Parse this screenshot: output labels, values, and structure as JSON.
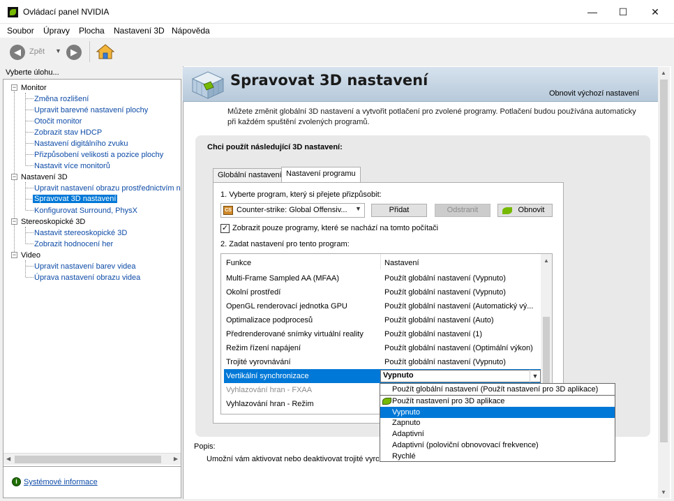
{
  "window": {
    "title": "Ovládací panel NVIDIA",
    "minimize": "—",
    "maximize": "☐",
    "close": "✕"
  },
  "menu": [
    "Soubor",
    "Úpravy",
    "Plocha",
    "Nastavení 3D",
    "Nápověda"
  ],
  "toolbar": {
    "back_label": "Zpět",
    "back_glyph": "◀",
    "forward_glyph": "▶",
    "dropdown_glyph": "▼"
  },
  "sidebar": {
    "header": "Vyberte úlohu...",
    "categories": [
      {
        "label": "Monitor",
        "tasks": [
          "Změna rozlišení",
          "Upravit barevné nastavení plochy",
          "Otočit monitor",
          "Zobrazit stav HDCP",
          "Nastavení digitálního zvuku",
          "Přizpůsobení velikosti a pozice plochy",
          "Nastavit více monitorů"
        ]
      },
      {
        "label": "Nastavení 3D",
        "tasks": [
          "Upravit nastavení obrazu prostřednictvím n",
          "Spravovat 3D nastavení",
          "Konfigurovat Surround, PhysX"
        ]
      },
      {
        "label": "Stereoskopické 3D",
        "tasks": [
          "Nastavit stereoskopické 3D",
          "Zobrazit hodnocení her"
        ]
      },
      {
        "label": "Video",
        "tasks": [
          "Upravit nastavení barev videa",
          "Úprava nastavení obrazu videa"
        ]
      }
    ],
    "selected_task": "Spravovat 3D nastavení",
    "expander_glyph": "−",
    "system_info": "Systémové informace",
    "system_info_glyph": "i"
  },
  "main": {
    "title": "Spravovat 3D nastavení",
    "restore_defaults": "Obnovit výchozí nastavení",
    "description": "Můžete změnit globální 3D nastavení a vytvořit potlačení pro zvolené programy. Potlačení budou používána automaticky při každém spuštění zvolených programů.",
    "settings_heading": "Chci použít následující 3D nastavení:",
    "tabs": [
      "Globální nastavení",
      "Nastavení programu"
    ],
    "active_tab": "Nastavení programu",
    "step1": "1. Vyberte program, který si přejete přizpůsobit:",
    "program": {
      "name": "Counter-strike: Global Offensiv...",
      "icon": "cs-icon",
      "icon_text": "CS"
    },
    "add_button": "Přidat",
    "remove_button": "Odstranit",
    "refresh_button": "Obnovit",
    "checkbox_label": "Zobrazit pouze programy, které se nachází na tomto počítači",
    "checkbox_checked": true,
    "checkbox_glyph": "✓",
    "step2": "2. Zadat nastavení pro tento program:",
    "table": {
      "headers": [
        "Funkce",
        "Nastavení"
      ],
      "rows": [
        {
          "feature": "Multi-Frame Sampled AA (MFAA)",
          "setting": "Použít globální nastavení (Vypnuto)"
        },
        {
          "feature": "Okolní prostředí",
          "setting": "Použít globální nastavení (Vypnuto)"
        },
        {
          "feature": "OpenGL renderovací jednotka GPU",
          "setting": "Použít globální nastavení (Automatický vý..."
        },
        {
          "feature": "Optimalizace podprocesů",
          "setting": "Použít globální nastavení (Auto)"
        },
        {
          "feature": "Předrenderované snímky virtuální reality",
          "setting": "Použít globální nastavení (1)"
        },
        {
          "feature": "Režim řízení napájení",
          "setting": "Použít globální nastavení (Optimální výkon)"
        },
        {
          "feature": "Trojité vyrovnávání",
          "setting": "Použít globální nastavení (Vypnuto)"
        },
        {
          "feature": "Vertikální synchronizace",
          "setting": "Vypnuto"
        },
        {
          "feature": "Vyhlazování hran - FXAA",
          "setting": ""
        },
        {
          "feature": "Vyhlazování hran - Režim",
          "setting": ""
        }
      ],
      "selected_row": "Vertikální synchronizace",
      "disabled_row": "Vyhlazování hran - FXAA"
    },
    "dropdown": {
      "current": "Vypnuto",
      "options": [
        "Použít globální nastavení (Použít nastavení pro 3D aplikace)",
        "Použít nastavení pro 3D aplikace",
        "Vypnuto",
        "Zapnuto",
        "Adaptivní",
        "Adaptivní (poloviční obnovovací frekvence)",
        "Rychlé"
      ],
      "highlighted": "Vypnuto"
    },
    "popis_label": "Popis:",
    "popis_text": "Umožní vám aktivovat nebo deaktivovat trojité vyrovnávání"
  },
  "colors": {
    "accent": "#0078d7",
    "nvidia_green": "#76b900",
    "link": "#0c4aa6"
  }
}
